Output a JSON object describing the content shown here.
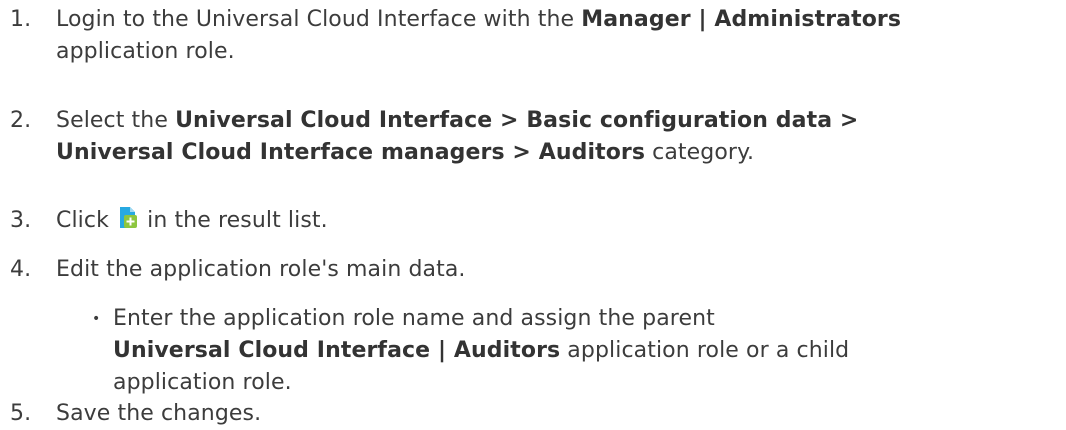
{
  "steps": [
    {
      "number": "1.",
      "line1_prefix": "Login to the Universal Cloud Interface with the ",
      "line1_bold": "Manager | Administrators",
      "line2": "application role."
    },
    {
      "number": "2.",
      "line1_prefix": "Select the ",
      "line1_bold": "Universal Cloud Interface > Basic configuration data >",
      "line2_bold": "Universal Cloud Interface managers > Auditors",
      "line2_suffix": " category."
    },
    {
      "number": "3.",
      "prefix": "Click ",
      "icon": "add-document-icon",
      "suffix": " in the result list."
    },
    {
      "number": "4.",
      "text": "Edit the application role's main data.",
      "bullet": {
        "line1": "Enter the application role name and assign the parent",
        "line2_bold": "Universal Cloud Interface | Auditors",
        "line2_suffix": " application role or a child",
        "line3": "application role."
      }
    },
    {
      "number": "5.",
      "text": "Save the changes."
    }
  ],
  "colors": {
    "text": "#3c3c3c",
    "icon_page": "#27a9e1",
    "icon_plus": "#8dc63f"
  }
}
